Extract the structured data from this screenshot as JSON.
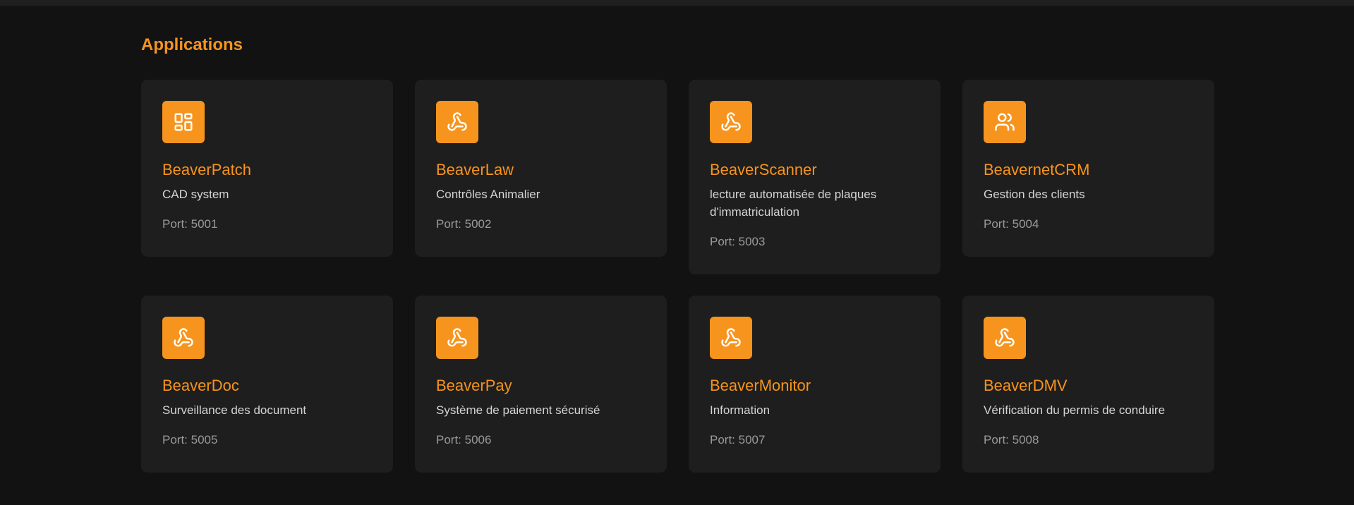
{
  "page": {
    "title": "Applications"
  },
  "colors": {
    "accent": "#f7941d",
    "background": "#121212",
    "card": "#1e1e1e"
  },
  "apps": [
    {
      "name": "BeaverPatch",
      "description": "CAD system",
      "port": "Port: 5001",
      "icon": "layout-dashboard-icon"
    },
    {
      "name": "BeaverLaw",
      "description": "Contrôles Animalier",
      "port": "Port: 5002",
      "icon": "webhook-icon"
    },
    {
      "name": "BeaverScanner",
      "description": "lecture automatisée de plaques d'immatriculation",
      "port": "Port: 5003",
      "icon": "webhook-icon"
    },
    {
      "name": "BeavernetCRM",
      "description": "Gestion des clients",
      "port": "Port: 5004",
      "icon": "users-icon"
    },
    {
      "name": "BeaverDoc",
      "description": "Surveillance des document",
      "port": "Port: 5005",
      "icon": "webhook-icon"
    },
    {
      "name": "BeaverPay",
      "description": "Système de paiement sécurisé",
      "port": "Port: 5006",
      "icon": "webhook-icon"
    },
    {
      "name": "BeaverMonitor",
      "description": "Information",
      "port": "Port: 5007",
      "icon": "webhook-icon"
    },
    {
      "name": "BeaverDMV",
      "description": "Vérification du permis de conduire",
      "port": "Port: 5008",
      "icon": "webhook-icon"
    }
  ]
}
